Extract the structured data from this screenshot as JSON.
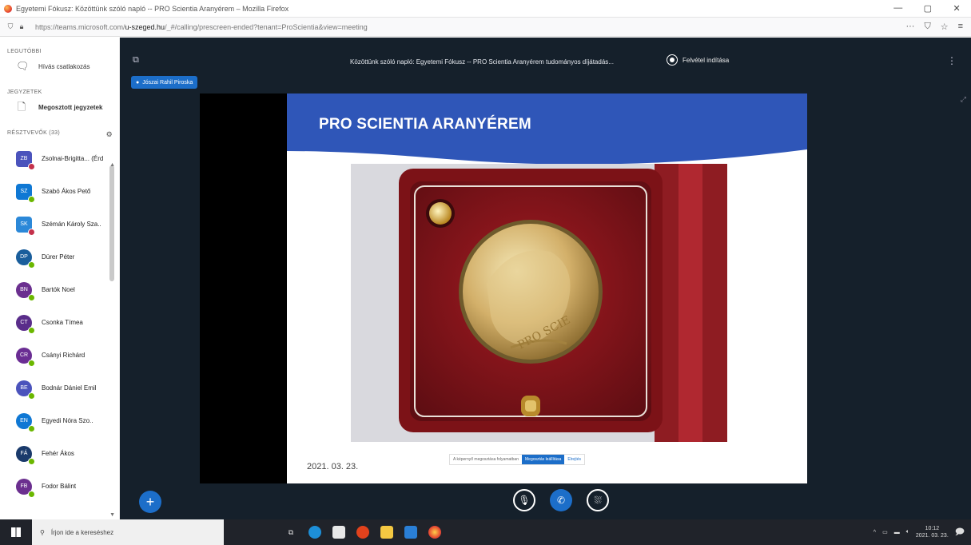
{
  "browser": {
    "title": "Egyetemi Fókusz: Közöttünk szóló napló -- PRO Scientia Aranyérem – Mozilla Firefox",
    "controls": [
      "—",
      "▢",
      "✕"
    ],
    "url_prefix": "https://teams.microsoft.com/",
    "url_host": "u-szeged.hu",
    "url_rest": "/_#/calling/prescreen-ended?tenant=ProScientia&view=meeting"
  },
  "sidebar": {
    "section1": "LEGUTÓBBI",
    "item1": "Hívás csatlakozás",
    "section2": "JEGYZETEK",
    "item2": "Megosztott jegyzetek",
    "section3": "RÉSZTVEVŐK (33)",
    "participants": [
      {
        "initials": "ZB",
        "name": "Zsolnai-Brigitta... (Érd",
        "color": "#4b53bc",
        "status": "#c4314b",
        "round": false
      },
      {
        "initials": "SZ",
        "name": "Szabó Ákos Pető",
        "color": "#0f78d4",
        "status": "#6bb700",
        "round": false
      },
      {
        "initials": "SK",
        "name": "Szémán Károly Sza..",
        "color": "#2b88d8",
        "status": "#c4314b",
        "round": false
      },
      {
        "initials": "DP",
        "name": "Dürer Péter",
        "color": "#1a5e9c",
        "status": "#6bb700",
        "round": true
      },
      {
        "initials": "BN",
        "name": "Bartók Noel",
        "color": "#6b2f8f",
        "status": "#6bb700",
        "round": true
      },
      {
        "initials": "CT",
        "name": "Csonka Tímea",
        "color": "#5a2d8a",
        "status": "#6bb700",
        "round": true
      },
      {
        "initials": "CR",
        "name": "Csányi Richárd",
        "color": "#6a2d93",
        "status": "#6bb700",
        "round": true
      },
      {
        "initials": "BE",
        "name": "Bodnár Dániel Emil",
        "color": "#4b53bc",
        "status": "#6bb700",
        "round": true
      },
      {
        "initials": "EN",
        "name": "Egyedi Nóra Szo..",
        "color": "#0f78d4",
        "status": "#6bb700",
        "round": true
      },
      {
        "initials": "FÁ",
        "name": "Fehér Ákos",
        "color": "#1a3a6b",
        "status": "#6bb700",
        "round": true
      },
      {
        "initials": "FB",
        "name": "Fodor Bálint",
        "color": "#6b2f8f",
        "status": "#6bb700",
        "round": true
      }
    ]
  },
  "meeting": {
    "title": "Közöttünk szóló napló: Egyetemi Fókusz -- PRO Scientia Aranyérem tudományos díjátadás...",
    "record_label": "Felvétel indítása",
    "presenter": "Jószai Rahil Piroska",
    "slide_title": "PRO SCIENTIA ARANYÉREM",
    "slide_date": "2021. 03. 23.",
    "share_text": "A képernyő megosztása folyamatban",
    "share_stop": "Megosztás leállítása",
    "share_hide": "Elrejtés",
    "add": "+"
  },
  "taskbar": {
    "search_placeholder": "Írjon ide a kereséshez",
    "time": "10:12",
    "date": "2021. 03. 23."
  },
  "colors": {
    "accent": "#1c6ec9",
    "meeting_bg": "#15202b",
    "slide_banner": "#2f56b8"
  }
}
